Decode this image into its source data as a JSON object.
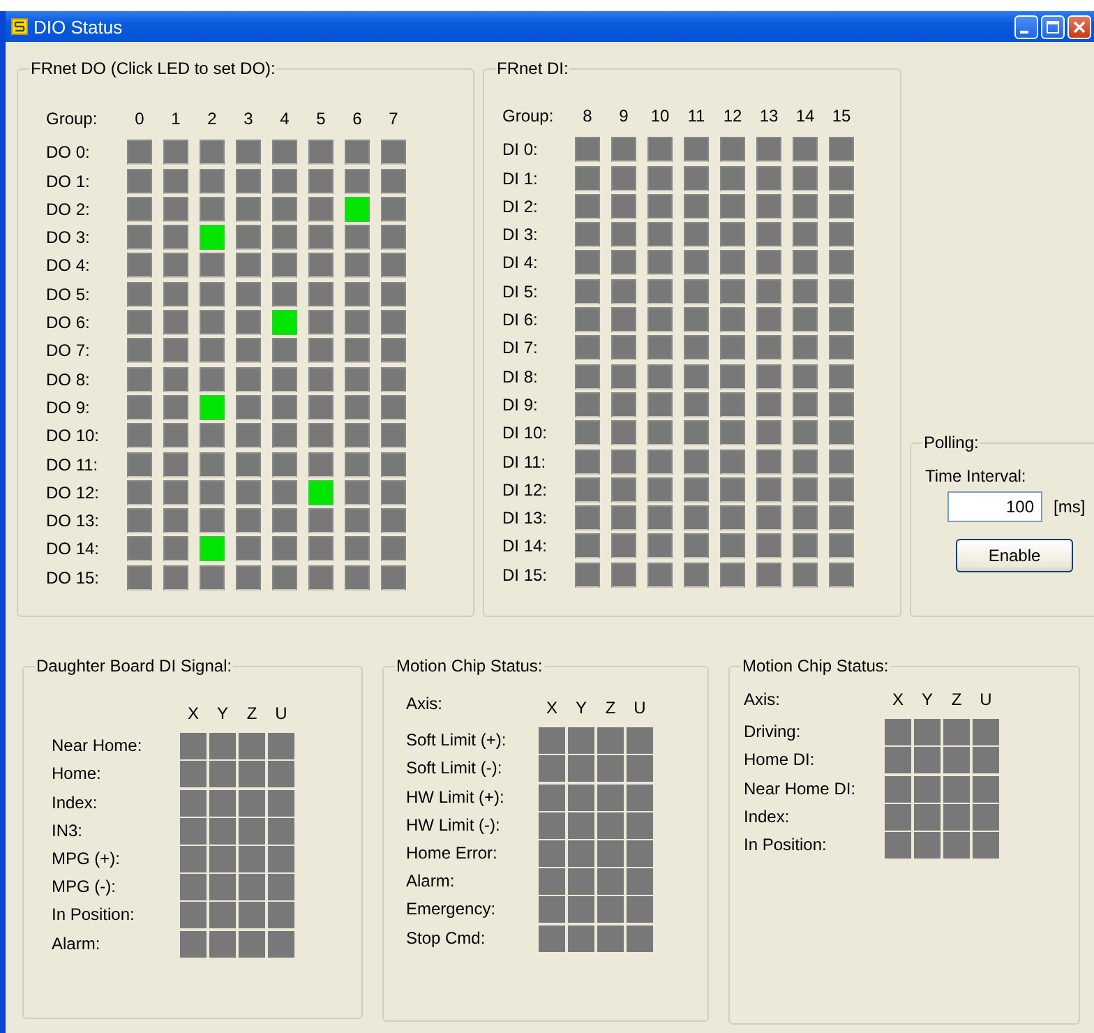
{
  "window": {
    "title": "DIO Status"
  },
  "do_panel": {
    "title": "FRnet DO (Click LED to set DO):",
    "group_label": "Group:",
    "columns": [
      "0",
      "1",
      "2",
      "3",
      "4",
      "5",
      "6",
      "7"
    ],
    "rows": [
      {
        "label": "DO 0:",
        "leds": [
          false,
          false,
          false,
          false,
          false,
          false,
          false,
          false
        ]
      },
      {
        "label": "DO 1:",
        "leds": [
          false,
          false,
          false,
          false,
          false,
          false,
          false,
          false
        ]
      },
      {
        "label": "DO 2:",
        "leds": [
          false,
          false,
          false,
          false,
          false,
          false,
          true,
          false
        ]
      },
      {
        "label": "DO 3:",
        "leds": [
          false,
          false,
          true,
          false,
          false,
          false,
          false,
          false
        ]
      },
      {
        "label": "DO 4:",
        "leds": [
          false,
          false,
          false,
          false,
          false,
          false,
          false,
          false
        ]
      },
      {
        "label": "DO 5:",
        "leds": [
          false,
          false,
          false,
          false,
          false,
          false,
          false,
          false
        ]
      },
      {
        "label": "DO 6:",
        "leds": [
          false,
          false,
          false,
          false,
          true,
          false,
          false,
          false
        ]
      },
      {
        "label": "DO 7:",
        "leds": [
          false,
          false,
          false,
          false,
          false,
          false,
          false,
          false
        ]
      },
      {
        "label": "DO 8:",
        "leds": [
          false,
          false,
          false,
          false,
          false,
          false,
          false,
          false
        ]
      },
      {
        "label": "DO 9:",
        "leds": [
          false,
          false,
          true,
          false,
          false,
          false,
          false,
          false
        ]
      },
      {
        "label": "DO 10:",
        "leds": [
          false,
          false,
          false,
          false,
          false,
          false,
          false,
          false
        ]
      },
      {
        "label": "DO 11:",
        "leds": [
          false,
          false,
          false,
          false,
          false,
          false,
          false,
          false
        ]
      },
      {
        "label": "DO 12:",
        "leds": [
          false,
          false,
          false,
          false,
          false,
          true,
          false,
          false
        ]
      },
      {
        "label": "DO 13:",
        "leds": [
          false,
          false,
          false,
          false,
          false,
          false,
          false,
          false
        ]
      },
      {
        "label": "DO 14:",
        "leds": [
          false,
          false,
          true,
          false,
          false,
          false,
          false,
          false
        ]
      },
      {
        "label": "DO 15:",
        "leds": [
          false,
          false,
          false,
          false,
          false,
          false,
          false,
          false
        ]
      }
    ]
  },
  "di_panel": {
    "title": "FRnet DI:",
    "group_label": "Group:",
    "columns": [
      "8",
      "9",
      "10",
      "11",
      "12",
      "13",
      "14",
      "15"
    ],
    "rows": [
      {
        "label": "DI 0:",
        "leds": [
          false,
          false,
          false,
          false,
          false,
          false,
          false,
          false
        ]
      },
      {
        "label": "DI 1:",
        "leds": [
          false,
          false,
          false,
          false,
          false,
          false,
          false,
          false
        ]
      },
      {
        "label": "DI 2:",
        "leds": [
          false,
          false,
          false,
          false,
          false,
          false,
          false,
          false
        ]
      },
      {
        "label": "DI 3:",
        "leds": [
          false,
          false,
          false,
          false,
          false,
          false,
          false,
          false
        ]
      },
      {
        "label": "DI 4:",
        "leds": [
          false,
          false,
          false,
          false,
          false,
          false,
          false,
          false
        ]
      },
      {
        "label": "DI 5:",
        "leds": [
          false,
          false,
          false,
          false,
          false,
          false,
          false,
          false
        ]
      },
      {
        "label": "DI 6:",
        "leds": [
          false,
          false,
          false,
          false,
          false,
          false,
          false,
          false
        ]
      },
      {
        "label": "DI 7:",
        "leds": [
          false,
          false,
          false,
          false,
          false,
          false,
          false,
          false
        ]
      },
      {
        "label": "DI 8:",
        "leds": [
          false,
          false,
          false,
          false,
          false,
          false,
          false,
          false
        ]
      },
      {
        "label": "DI 9:",
        "leds": [
          false,
          false,
          false,
          false,
          false,
          false,
          false,
          false
        ]
      },
      {
        "label": "DI 10:",
        "leds": [
          false,
          false,
          false,
          false,
          false,
          false,
          false,
          false
        ]
      },
      {
        "label": "DI 11:",
        "leds": [
          false,
          false,
          false,
          false,
          false,
          false,
          false,
          false
        ]
      },
      {
        "label": "DI 12:",
        "leds": [
          false,
          false,
          false,
          false,
          false,
          false,
          false,
          false
        ]
      },
      {
        "label": "DI 13:",
        "leds": [
          false,
          false,
          false,
          false,
          false,
          false,
          false,
          false
        ]
      },
      {
        "label": "DI 14:",
        "leds": [
          false,
          false,
          false,
          false,
          false,
          false,
          false,
          false
        ]
      },
      {
        "label": "DI 15:",
        "leds": [
          false,
          false,
          false,
          false,
          false,
          false,
          false,
          false
        ]
      }
    ]
  },
  "polling": {
    "title": "Polling:",
    "interval_label": "Time Interval:",
    "interval_value": "100",
    "unit": "[ms]",
    "button": "Enable"
  },
  "daughter_board": {
    "title": "Daughter Board DI Signal:",
    "columns": [
      "X",
      "Y",
      "Z",
      "U"
    ],
    "rows": [
      {
        "label": "Near Home:",
        "leds": [
          false,
          false,
          false,
          false
        ]
      },
      {
        "label": "Home:",
        "leds": [
          false,
          false,
          false,
          false
        ]
      },
      {
        "label": "Index:",
        "leds": [
          false,
          false,
          false,
          false
        ]
      },
      {
        "label": "IN3:",
        "leds": [
          false,
          false,
          false,
          false
        ]
      },
      {
        "label": "MPG (+):",
        "leds": [
          false,
          false,
          false,
          false
        ]
      },
      {
        "label": "MPG (-):",
        "leds": [
          false,
          false,
          false,
          false
        ]
      },
      {
        "label": "In Position:",
        "leds": [
          false,
          false,
          false,
          false
        ]
      },
      {
        "label": "Alarm:",
        "leds": [
          false,
          false,
          false,
          false
        ]
      }
    ]
  },
  "motion_status_1": {
    "title": "Motion Chip Status:",
    "axis_label": "Axis:",
    "columns": [
      "X",
      "Y",
      "Z",
      "U"
    ],
    "rows": [
      {
        "label": "Soft Limit (+):",
        "leds": [
          false,
          false,
          false,
          false
        ]
      },
      {
        "label": "Soft Limit (-):",
        "leds": [
          false,
          false,
          false,
          false
        ]
      },
      {
        "label": "HW Limit (+):",
        "leds": [
          false,
          false,
          false,
          false
        ]
      },
      {
        "label": "HW Limit (-):",
        "leds": [
          false,
          false,
          false,
          false
        ]
      },
      {
        "label": "Home Error:",
        "leds": [
          false,
          false,
          false,
          false
        ]
      },
      {
        "label": "Alarm:",
        "leds": [
          false,
          false,
          false,
          false
        ]
      },
      {
        "label": "Emergency:",
        "leds": [
          false,
          false,
          false,
          false
        ]
      },
      {
        "label": "Stop Cmd:",
        "leds": [
          false,
          false,
          false,
          false
        ]
      }
    ]
  },
  "motion_status_2": {
    "title": "Motion Chip Status:",
    "axis_label": "Axis:",
    "columns": [
      "X",
      "Y",
      "Z",
      "U"
    ],
    "rows": [
      {
        "label": "Driving:",
        "leds": [
          false,
          false,
          false,
          false
        ]
      },
      {
        "label": "Home DI:",
        "leds": [
          false,
          false,
          false,
          false
        ]
      },
      {
        "label": "Near Home DI:",
        "leds": [
          false,
          false,
          false,
          false
        ]
      },
      {
        "label": "Index:",
        "leds": [
          false,
          false,
          false,
          false
        ]
      },
      {
        "label": "In Position:",
        "leds": [
          false,
          false,
          false,
          false
        ]
      }
    ]
  }
}
